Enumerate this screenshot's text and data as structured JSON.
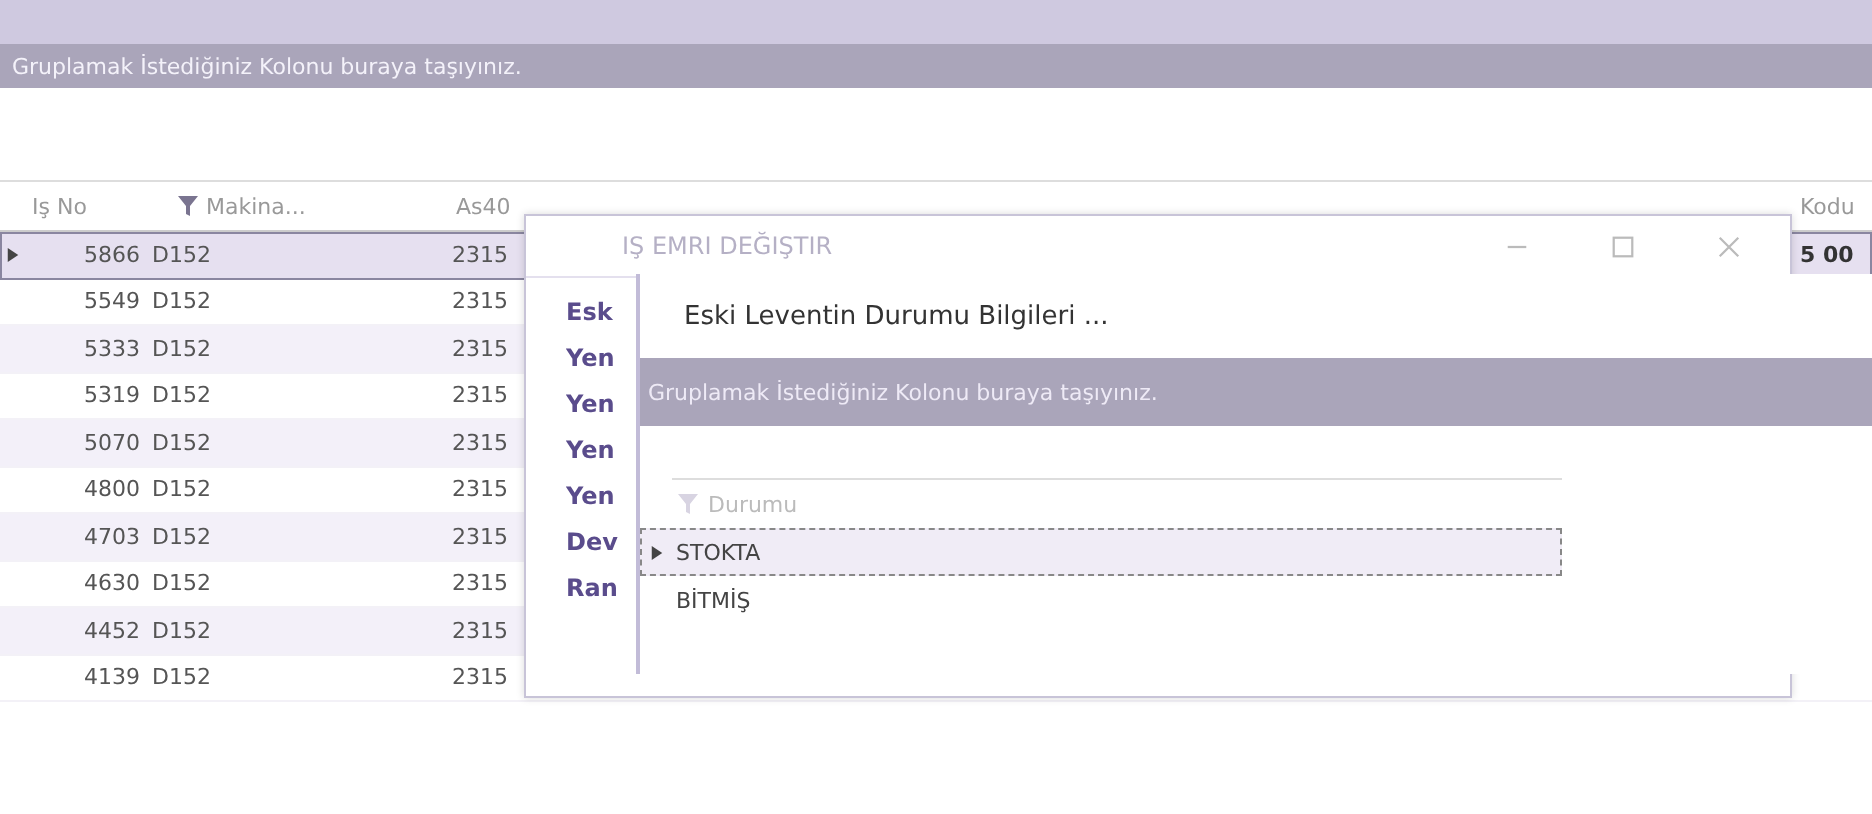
{
  "main": {
    "group_panel": "Gruplamak İstediğiniz Kolonu buraya taşıyınız.",
    "columns": [
      {
        "label": "Iş No",
        "filter": false
      },
      {
        "label": "Makina...",
        "filter": true
      },
      {
        "label": "As40",
        "filter": false
      },
      {
        "label": "Kodu",
        "filter": false
      }
    ],
    "rows": [
      {
        "is_no": "5866",
        "makina": "D152",
        "column_3": "2315",
        "kodu": "5 00",
        "selected": true
      },
      {
        "is_no": "5549",
        "makina": "D152",
        "column_3": "2315",
        "selected": false
      },
      {
        "is_no": "5333",
        "makina": "D152",
        "column_3": "2315",
        "selected": false
      },
      {
        "is_no": "5319",
        "makina": "D152",
        "column_3": "2315",
        "selected": false
      },
      {
        "is_no": "5070",
        "makina": "D152",
        "column_3": "2315",
        "selected": false
      },
      {
        "is_no": "4800",
        "makina": "D152",
        "column_3": "2315",
        "selected": false
      },
      {
        "is_no": "4703",
        "makina": "D152",
        "column_3": "2315",
        "selected": false
      },
      {
        "is_no": "4630",
        "makina": "D152",
        "column_3": "2315",
        "selected": false
      },
      {
        "is_no": "4452",
        "makina": "D152",
        "column_3": "2315",
        "selected": false
      },
      {
        "is_no": "4139",
        "makina": "D152",
        "column_3": "2315",
        "selected": false
      }
    ]
  },
  "dialog": {
    "title": "IŞ EMRI DEĞIŞTIR",
    "labels": [
      "Esk",
      "Yen",
      "Yen",
      "Yen",
      "Yen",
      "Dev",
      "Ran"
    ]
  },
  "subdialog": {
    "heading": "Eski Leventin Durumu Bilgileri ...",
    "group_panel": "Gruplamak İstediğiniz Kolonu buraya taşıyınız.",
    "column": "Durumu",
    "rows": [
      {
        "label": "STOKTA",
        "selected": true
      },
      {
        "label": "BİTMİŞ",
        "selected": false
      }
    ]
  }
}
